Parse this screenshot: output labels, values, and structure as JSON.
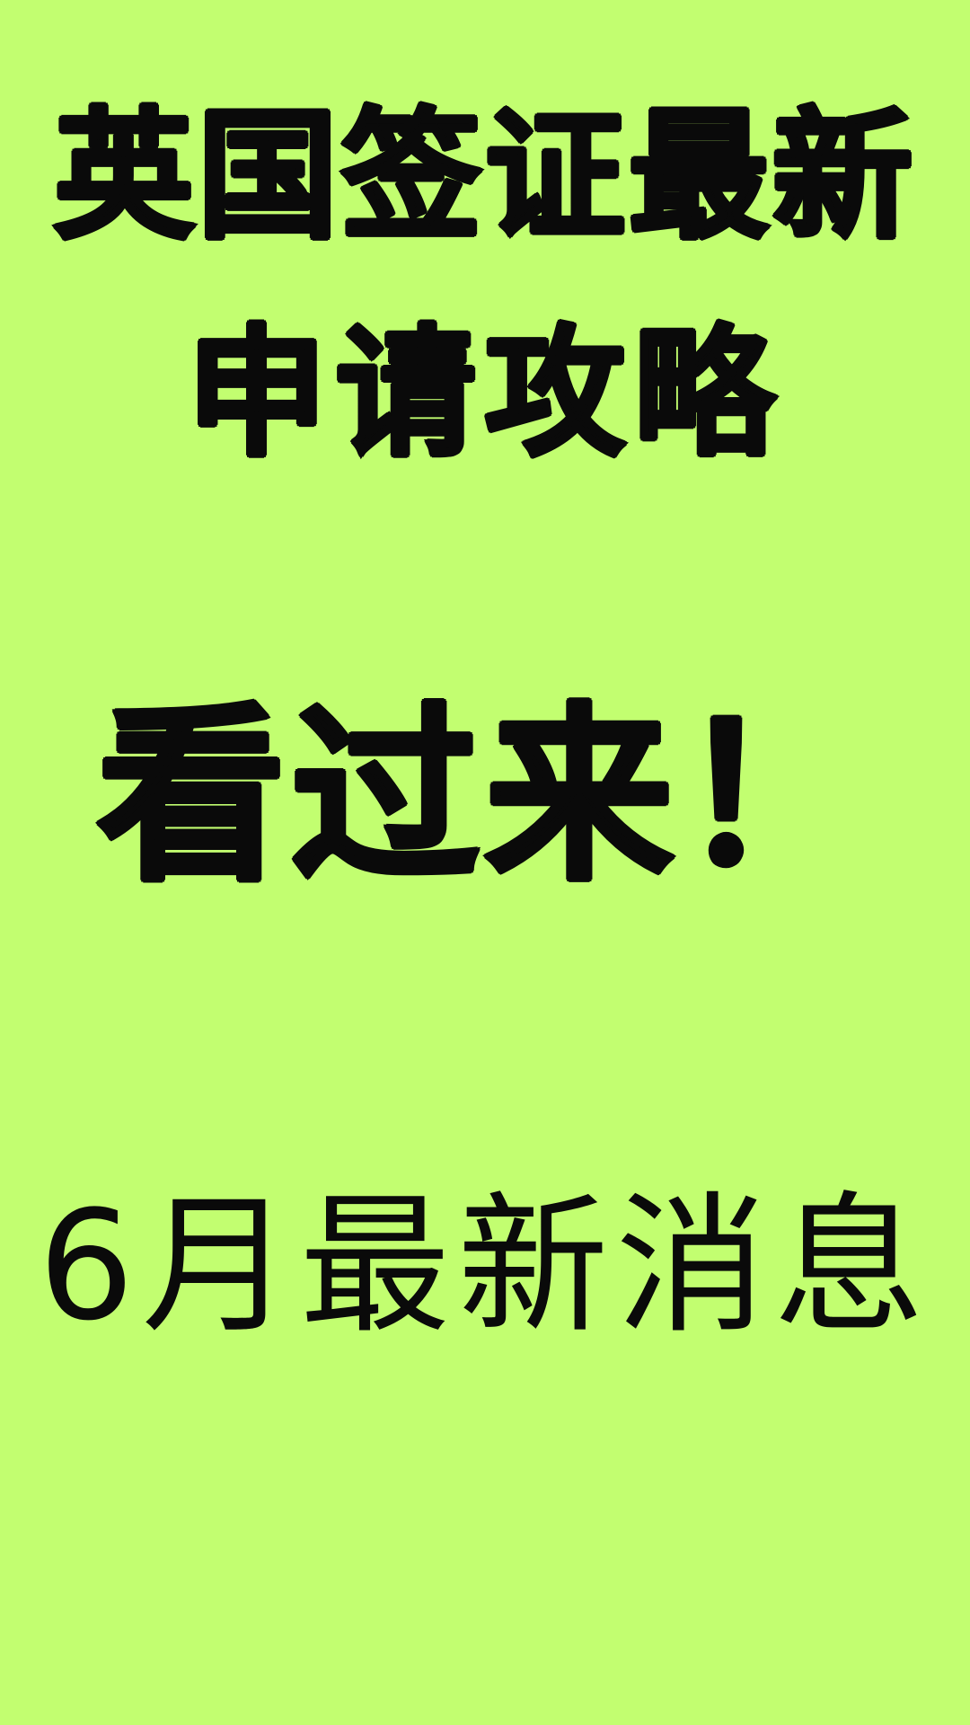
{
  "poster": {
    "background_color": "#c2fe70",
    "text_color": "#0a0a0a",
    "title_line1": "英国签证最新",
    "title_line2": "申请攻略",
    "call_to_action": "看过来！",
    "subtitle": "6月最新消息"
  }
}
